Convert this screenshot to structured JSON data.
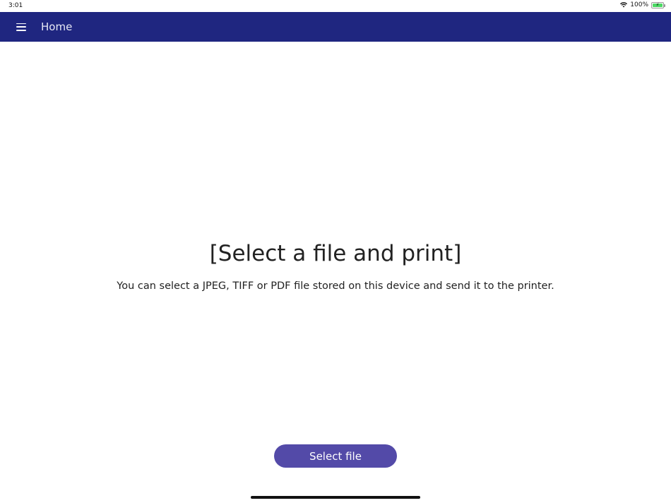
{
  "status_bar": {
    "time": "3:01",
    "battery_percent": "100%",
    "battery_level": 1.0,
    "icons": [
      "wifi-icon",
      "battery-charging-icon"
    ]
  },
  "app_bar": {
    "title": "Home",
    "menu_icon": "hamburger-menu-icon",
    "background": "#1f2680"
  },
  "main": {
    "headline": "[Select a file and print]",
    "description": "You can select a JPEG, TIFF or PDF file stored on this device and send it to the printer."
  },
  "actions": {
    "select_file_label": "Select file",
    "button_color": "#534aa8"
  }
}
